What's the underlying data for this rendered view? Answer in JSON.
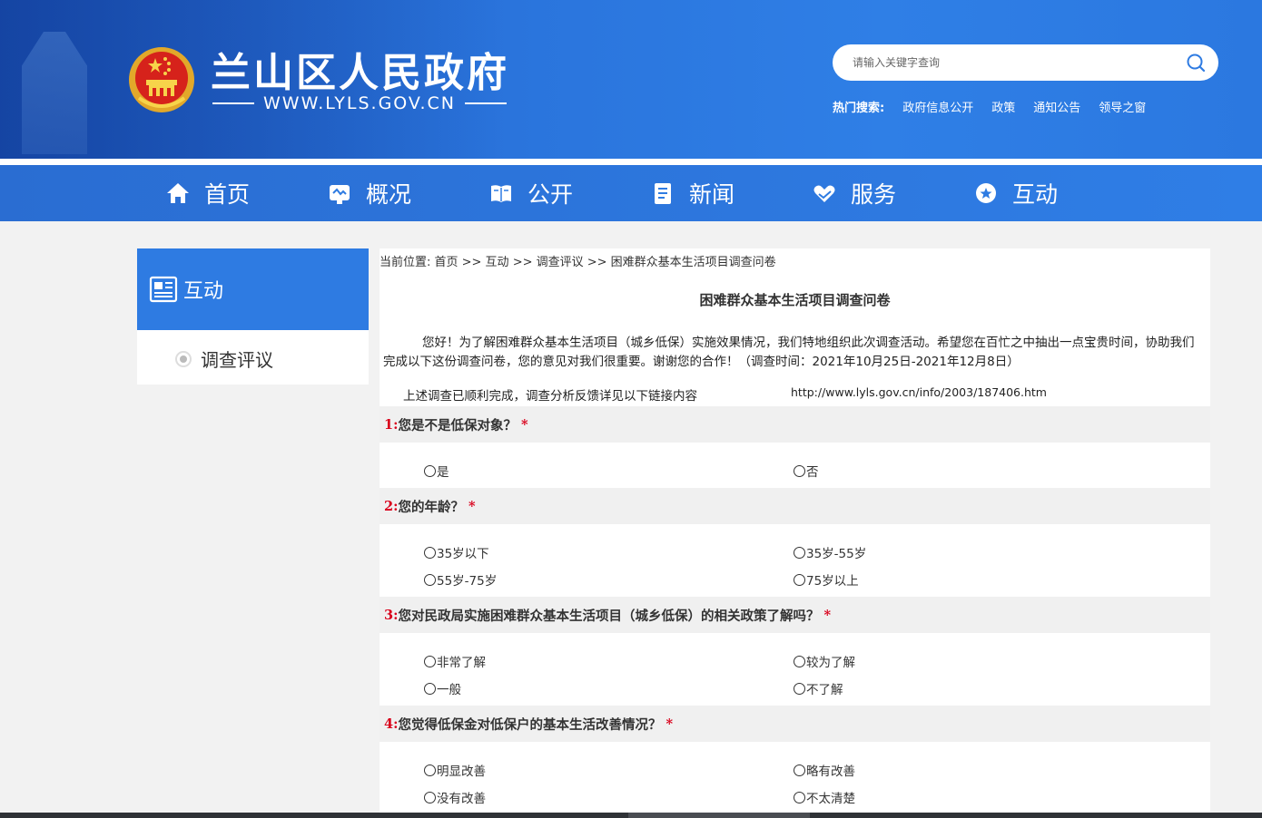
{
  "header": {
    "site_title": "兰山区人民政府",
    "site_url": "WWW.LYLS.GOV.CN",
    "search_placeholder": "请输入关键字查询",
    "hot_label": "热门搜索:",
    "hot_links": [
      "政府信息公开",
      "政策",
      "通知公告",
      "领导之窗"
    ]
  },
  "nav": [
    {
      "label": "首页",
      "icon": "home-icon"
    },
    {
      "label": "概况",
      "icon": "overview-icon"
    },
    {
      "label": "公开",
      "icon": "book-icon"
    },
    {
      "label": "新闻",
      "icon": "news-icon"
    },
    {
      "label": "服务",
      "icon": "heart-hand-icon"
    },
    {
      "label": "互动",
      "icon": "chat-star-icon"
    }
  ],
  "sidebar": {
    "title": "互动",
    "items": [
      "调查评议"
    ]
  },
  "breadcrumb": "当前位置: 首页 >> 互动 >> 调查评议 >> 困难群众基本生活项目调查问卷",
  "survey": {
    "title": "困难群众基本生活项目调查问卷",
    "intro": "您好！为了解困难群众基本生活项目（城乡低保）实施效果情况，我们特地组织此次调查活动。希望您在百忙之中抽出一点宝贵时间，协助我们完成以下这份调查问卷，您的意见对我们很重要。谢谢您的合作！（调查时间：2021年10月25日-2021年12月8日）",
    "done_text": "上述调查已顺利完成，调查分析反馈详见以下链接内容",
    "done_link": "http://www.lyls.gov.cn/info/2003/187406.htm",
    "questions": [
      {
        "num": "1:",
        "text": "您是不是低保对象？",
        "req": "*",
        "options": [
          "是",
          "否"
        ]
      },
      {
        "num": "2:",
        "text": "您的年龄？",
        "req": "*",
        "options": [
          "35岁以下",
          "35岁-55岁",
          "55岁-75岁",
          "75岁以上"
        ]
      },
      {
        "num": "3:",
        "text": "您对民政局实施困难群众基本生活项目（城乡低保）的相关政策了解吗？",
        "req": "*",
        "options": [
          "非常了解",
          "较为了解",
          "一般",
          "不了解"
        ]
      },
      {
        "num": "4:",
        "text": "您觉得低保金对低保户的基本生活改善情况？",
        "req": "*",
        "options": [
          "明显改善",
          "略有改善",
          "没有改善",
          "不太清楚"
        ]
      }
    ]
  },
  "colors": {
    "primary": "#2e7be2",
    "required": "#d9001b"
  }
}
